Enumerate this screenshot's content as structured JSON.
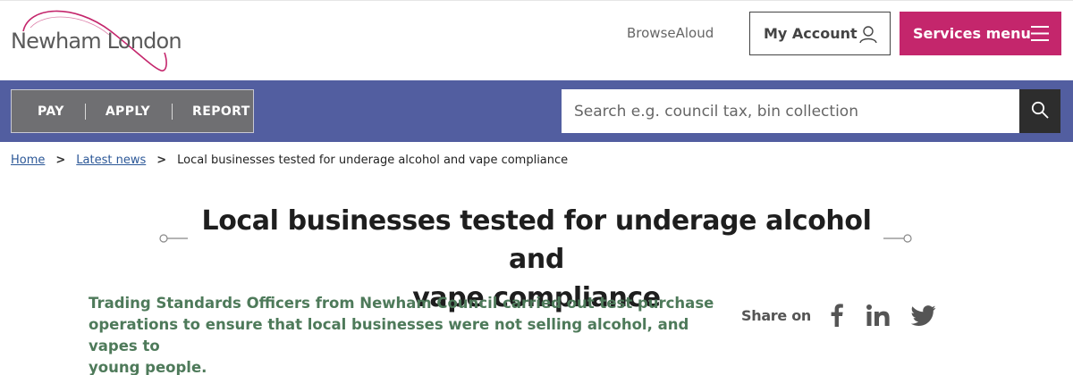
{
  "header": {
    "logo_text": "Newham London",
    "browsealoud_label": "BrowseAloud",
    "my_account_label": "My Account",
    "services_menu_label": "Services menu",
    "colors": {
      "brand": "#c4266c",
      "nav": "#525ea0"
    }
  },
  "quick_links": [
    {
      "label": "PAY"
    },
    {
      "label": "APPLY"
    },
    {
      "label": "REPORT"
    }
  ],
  "search": {
    "placeholder": "Search e.g. council tax, bin collection",
    "value": "",
    "button_icon": "search-icon"
  },
  "breadcrumb": {
    "items": [
      {
        "label": "Home"
      },
      {
        "label": "Latest news"
      }
    ],
    "current": "Local businesses tested for underage alcohol and vape compliance",
    "separator": ">"
  },
  "article": {
    "title_line1": "Local businesses tested for underage alcohol and",
    "title_line2": "vape compliance",
    "summary_line1": "Trading Standards Officers from Newham Council carried out test purchase",
    "summary_line2": "operations to ensure that local businesses were not selling alcohol, and vapes to",
    "summary_line3": "young people.",
    "summary_color": "#4e7a5a"
  },
  "share": {
    "label": "Share on",
    "networks": [
      "facebook-icon",
      "linkedin-icon",
      "twitter-icon"
    ]
  }
}
